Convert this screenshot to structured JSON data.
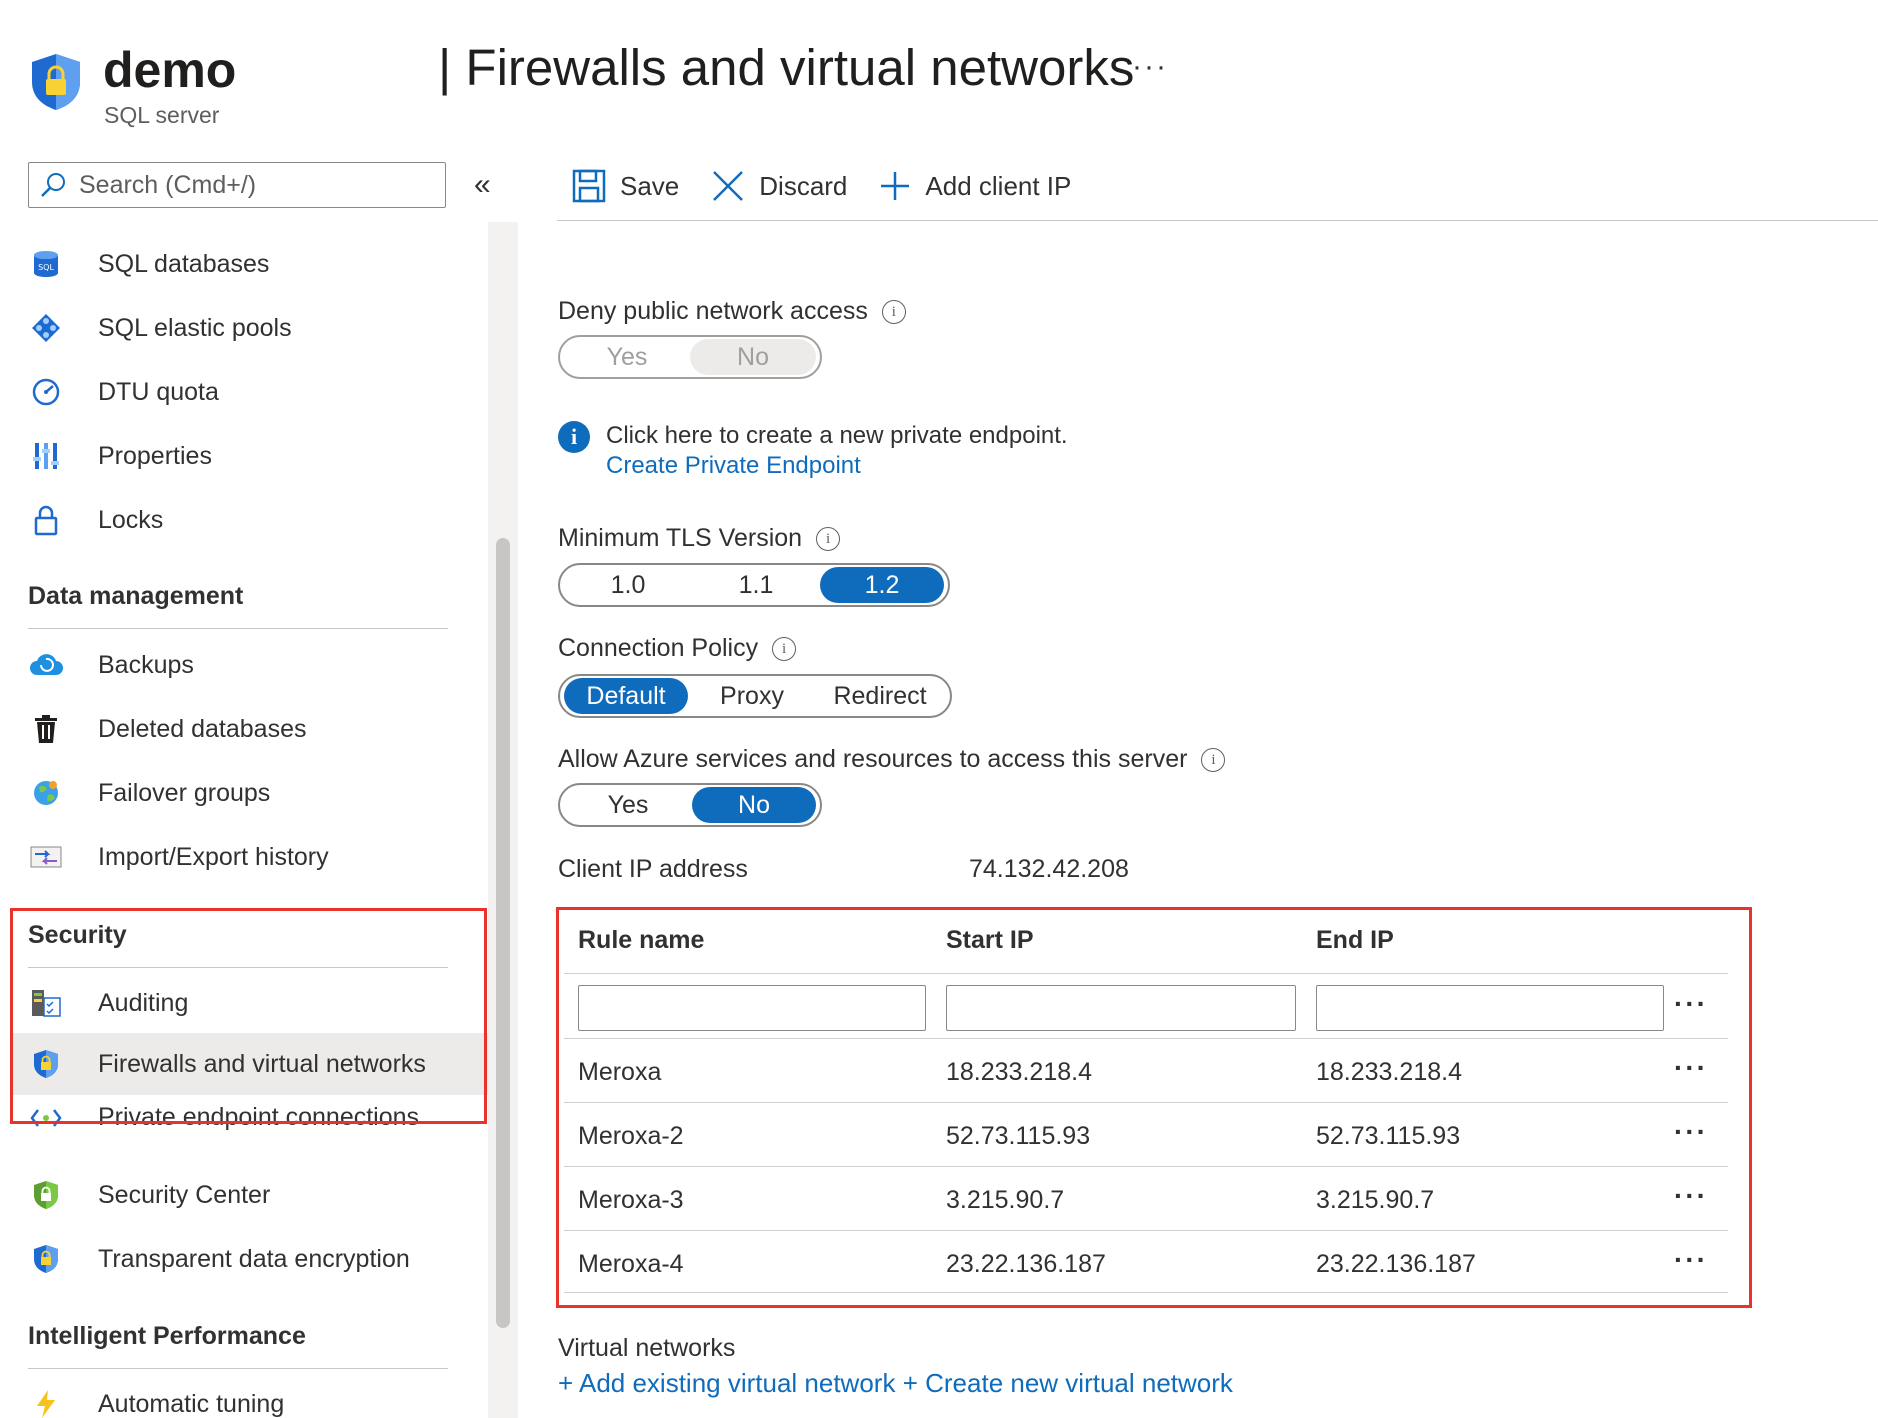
{
  "header": {
    "resource_name": "demo",
    "resource_type": "SQL server",
    "page_title": "| Firewalls and virtual networks",
    "more": "···"
  },
  "sidebar": {
    "search_placeholder": "Search (Cmd+/)",
    "collapse": "«",
    "items_top": [
      {
        "label": "SQL databases",
        "icon": "sql-database-icon"
      },
      {
        "label": "SQL elastic pools",
        "icon": "elastic-pool-icon"
      },
      {
        "label": "DTU quota",
        "icon": "gauge-icon"
      },
      {
        "label": "Properties",
        "icon": "properties-icon"
      },
      {
        "label": "Locks",
        "icon": "lock-icon"
      }
    ],
    "data_management": {
      "heading": "Data management",
      "items": [
        {
          "label": "Backups",
          "icon": "cloud-backup-icon"
        },
        {
          "label": "Deleted databases",
          "icon": "trash-icon"
        },
        {
          "label": "Failover groups",
          "icon": "globe-icon"
        },
        {
          "label": "Import/Export history",
          "icon": "import-export-icon"
        }
      ]
    },
    "security": {
      "heading": "Security",
      "items": [
        {
          "label": "Auditing",
          "icon": "auditing-icon"
        },
        {
          "label": "Firewalls and virtual networks",
          "icon": "shield-lock-icon",
          "active": true
        },
        {
          "label": "Private endpoint connections",
          "icon": "private-endpoint-icon"
        },
        {
          "label": "Security Center",
          "icon": "security-center-icon"
        },
        {
          "label": "Transparent data encryption",
          "icon": "shield-lock-icon"
        }
      ]
    },
    "intelligent_performance": {
      "heading": "Intelligent Performance",
      "items": [
        {
          "label": "Automatic tuning",
          "icon": "lightning-icon"
        }
      ]
    }
  },
  "toolbar": {
    "save": "Save",
    "discard": "Discard",
    "add_client_ip": "Add client IP"
  },
  "main": {
    "deny_public": {
      "label": "Deny public network access",
      "options": [
        "Yes",
        "No"
      ],
      "selected": "No",
      "disabled": true
    },
    "private_endpoint": {
      "text": "Click here to create a new private endpoint.",
      "link": "Create Private Endpoint"
    },
    "tls": {
      "label": "Minimum TLS Version",
      "options": [
        "1.0",
        "1.1",
        "1.2"
      ],
      "selected": "1.2"
    },
    "connection_policy": {
      "label": "Connection Policy",
      "options": [
        "Default",
        "Proxy",
        "Redirect"
      ],
      "selected": "Default"
    },
    "allow_azure": {
      "label": "Allow Azure services and resources to access this server",
      "options": [
        "Yes",
        "No"
      ],
      "selected": "No"
    },
    "client_ip": {
      "label": "Client IP address",
      "value": "74.132.42.208"
    },
    "rules_table": {
      "headers": [
        "Rule name",
        "Start IP",
        "End IP"
      ],
      "new_row": {
        "rule_name": "",
        "start_ip": "",
        "end_ip": ""
      },
      "more": "···",
      "rows": [
        {
          "name": "Meroxa",
          "start": "18.233.218.4",
          "end": "18.233.218.4"
        },
        {
          "name": "Meroxa-2",
          "start": "52.73.115.93",
          "end": "52.73.115.93"
        },
        {
          "name": "Meroxa-3",
          "start": "3.215.90.7",
          "end": "3.215.90.7"
        },
        {
          "name": "Meroxa-4",
          "start": "23.22.136.187",
          "end": "23.22.136.187"
        }
      ]
    },
    "virtual_networks": {
      "label": "Virtual networks",
      "add_existing": "+ Add existing virtual network",
      "create_new": "+ Create new virtual network"
    }
  },
  "colors": {
    "accent": "#0f6cbd",
    "highlight_border": "#e8322b",
    "active_nav_bg": "#edebe9"
  }
}
